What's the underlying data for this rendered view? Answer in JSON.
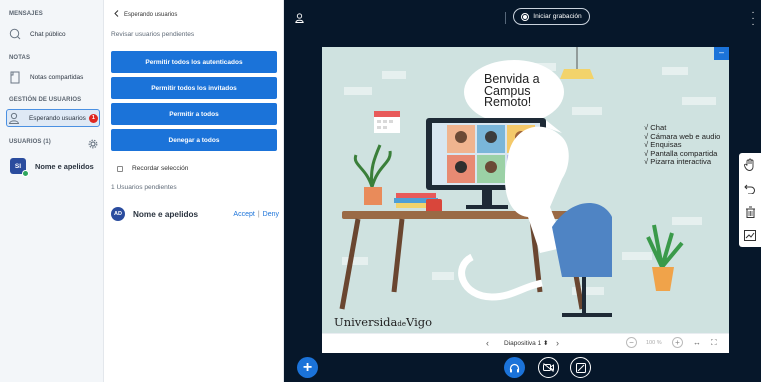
{
  "sidebar": {
    "messages_title": "MENSAJES",
    "public_chat": "Chat público",
    "notes_title": "NOTAS",
    "shared_notes": "Notas compartidas",
    "user_mgmt_title": "GESTIÓN DE USUARIOS",
    "waiting_users": "Esperando usuarios",
    "waiting_badge": "1",
    "users_title": "USUARIOS (1)",
    "user_initials": "SI",
    "user_name": "Nome e apelidos"
  },
  "waiting_panel": {
    "back_label": "Esperando usuarios",
    "review_label": "Revisar usuarios pendientes",
    "btn_allow_auth": "Permitir todos los autenticados",
    "btn_allow_guests": "Permitir todos los invitados",
    "btn_allow_all": "Permitir a todos",
    "btn_deny_all": "Denegar a todos",
    "remember_label": "Recordar selección",
    "pending_count": "1 Usuarios pendientes",
    "pending_user": {
      "initials": "AD",
      "name": "Nome e apelidos",
      "accept": "Accept",
      "separator": "|",
      "deny": "Deny"
    }
  },
  "main": {
    "record_label": "Iniciar grabación",
    "slide": {
      "bubble_line1": "Benvida a",
      "bubble_line2": "Campus",
      "bubble_line3": "Remoto!",
      "features": [
        "√ Chat",
        "√ Cámara web e audio",
        "√ Enquisas",
        "√ Pantalla compartida",
        "√ Pizarra interactiva"
      ],
      "logo_part1": "Universida",
      "logo_part2": "de",
      "logo_part3": "Vigo"
    },
    "slide_bar": {
      "slide_label": "Diapositiva 1",
      "zoom_value": "100 %"
    }
  },
  "colors": {
    "accent": "#1b73d9",
    "dark_bg": "#06172a",
    "sidebar_bg": "#f3f6f9",
    "badge": "#df2721",
    "slide_bg": "#cfe2e0"
  },
  "icons": [
    "chat-icon",
    "notes-icon",
    "user-icon",
    "gear-icon",
    "back-icon",
    "record-icon",
    "kebab-icon",
    "hand-icon",
    "undo-icon",
    "trash-icon",
    "multiuser-icon",
    "plus-icon",
    "headphones-icon",
    "camera-icon",
    "screen-share-icon"
  ]
}
